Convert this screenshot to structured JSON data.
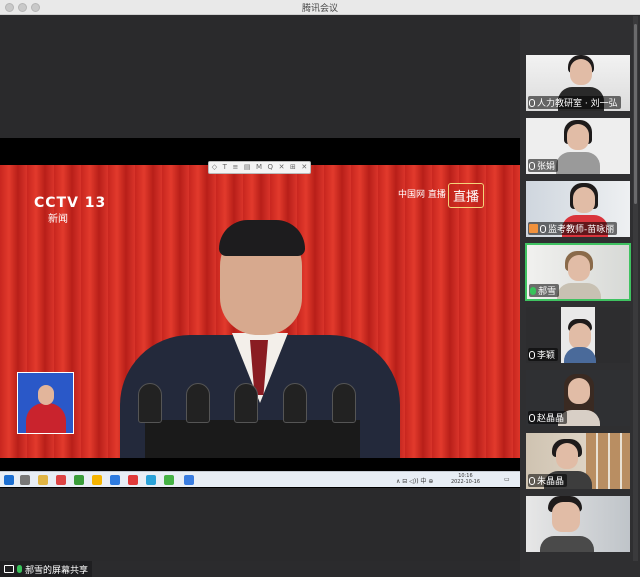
{
  "window": {
    "title": "腾讯会议"
  },
  "share": {
    "channel_logo": "CCTV 13",
    "channel_sub": "新闻",
    "live_logo": "中国网 直播",
    "live_badge": "直播",
    "toolbar_icons": [
      "◇",
      "T",
      "≡",
      "▤",
      "M",
      "Q",
      "✕",
      "⊞",
      "✕"
    ],
    "taskbar_time": "10:16",
    "taskbar_date": "2022-10-16"
  },
  "sharing_label": "郝雪的屏幕共享",
  "participants": [
    {
      "name": "人力教研室 · 刘一弘",
      "mic": "muted"
    },
    {
      "name": "张娟",
      "mic": "muted"
    },
    {
      "name": "监考教师-苗咏丽",
      "mic": "muted",
      "host": true
    },
    {
      "name": "郝雪",
      "mic": "on",
      "active": true
    },
    {
      "name": "李颖",
      "mic": "muted"
    },
    {
      "name": "赵晶晶",
      "mic": "muted"
    },
    {
      "name": "朱晶晶",
      "mic": "muted"
    },
    {
      "name": "",
      "mic": "muted"
    }
  ],
  "colors": {
    "accent_green": "#3fc261",
    "host_orange": "#f0913c"
  }
}
